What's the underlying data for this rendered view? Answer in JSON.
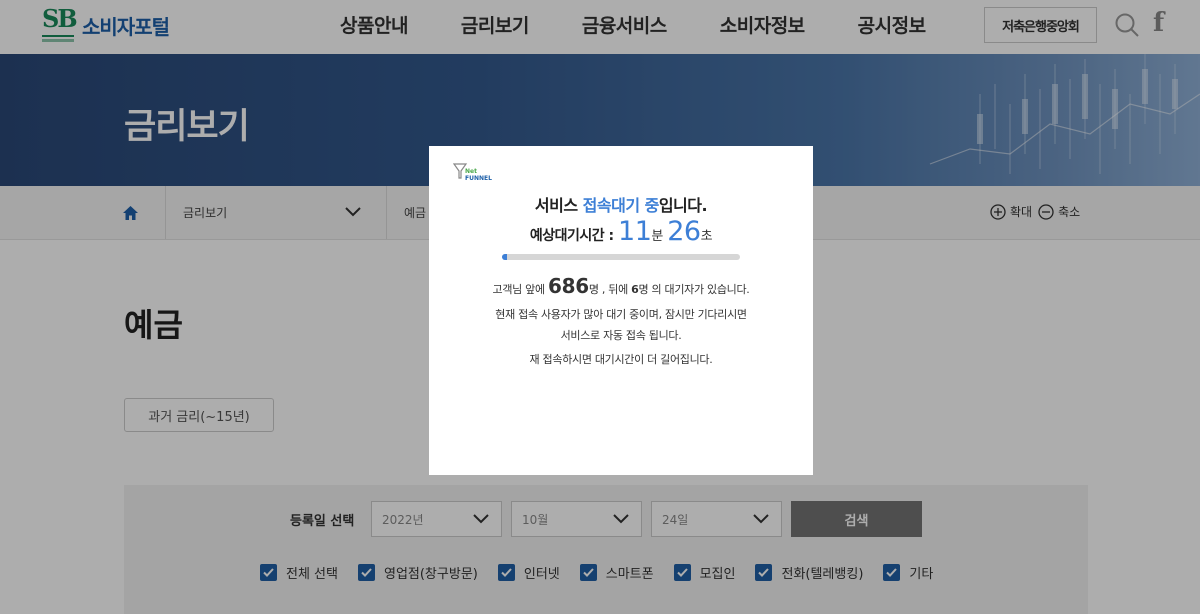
{
  "header": {
    "logo_text": "소비자포털",
    "nav": [
      "상품안내",
      "금리보기",
      "금융서비스",
      "소비자정보",
      "공시정보"
    ],
    "assoc_button": "저축은행중앙회"
  },
  "banner": {
    "title": "금리보기"
  },
  "breadcrumb": {
    "level1": "금리보기",
    "level2": "예금",
    "zoom_in": "확대",
    "zoom_out": "축소"
  },
  "content": {
    "page_title": "예금",
    "past_rates_button": "과거 금리(~15년)"
  },
  "filter": {
    "label": "등록일 선택",
    "year": "2022년",
    "month": "10월",
    "day": "24일",
    "search_button": "검색",
    "checkboxes": [
      "전체 선택",
      "영업점(창구방문)",
      "인터넷",
      "스마트폰",
      "모집인",
      "전화(텔레뱅킹)",
      "기타"
    ]
  },
  "netfunnel": {
    "line1_pre": "서비스 ",
    "line1_highlight": "접속대기 중",
    "line1_post": "입니다.",
    "wait_label": "예상대기시간 : ",
    "minutes": "11",
    "minutes_unit": "분",
    "seconds": "26",
    "seconds_unit": "초",
    "progress": 0.02,
    "count_pre": "고객님 앞에 ",
    "ahead": "686",
    "ahead_unit": "명 , 뒤에 ",
    "behind": "6",
    "count_post": "명 의 대기자가 있습니다.",
    "msg1": "현재 접속 사용자가 많아 대기 중이며, 잠시만 기다리시면",
    "msg2": "서비스로 자동 접속 됩니다.",
    "msg3": "재 접속하시면 대기시간이 더 길어집니다."
  },
  "colors": {
    "brand_green": "#1a8a5a",
    "brand_blue": "#1c5fa8",
    "accent_blue": "#3d7fd6",
    "checkbox_blue": "#1f5fa6",
    "search_button": "#747474"
  }
}
